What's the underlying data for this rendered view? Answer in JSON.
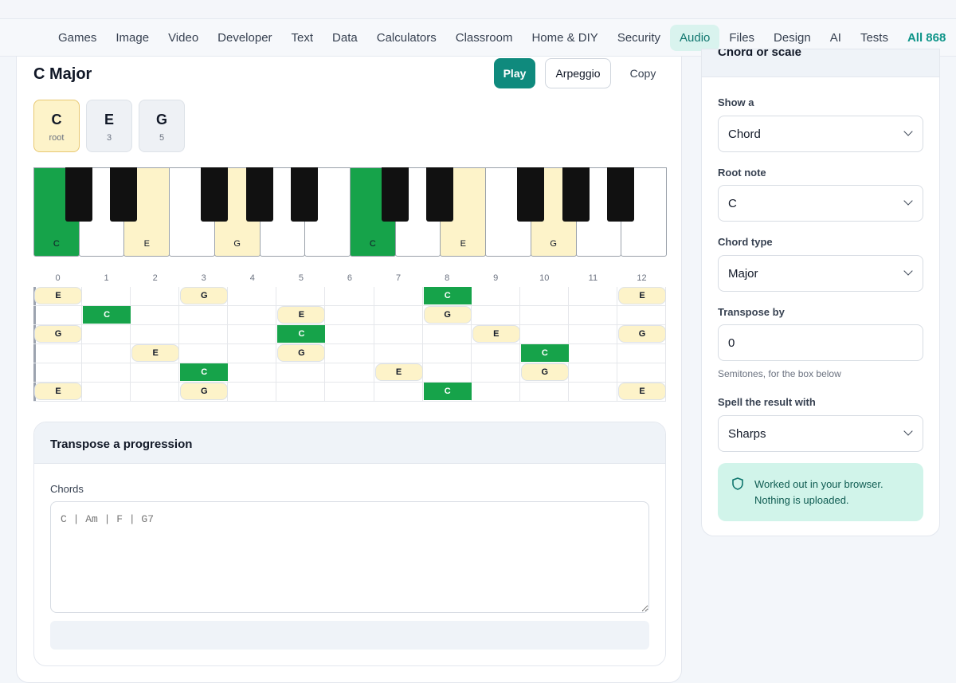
{
  "nav": {
    "items": [
      "Games",
      "Image",
      "Video",
      "Developer",
      "Text",
      "Data",
      "Calculators",
      "Classroom",
      "Home & DIY",
      "Security",
      "Audio",
      "Files",
      "Design",
      "AI",
      "Tests"
    ],
    "active": "Audio",
    "all_label": "All 868"
  },
  "chord": {
    "title": "C Major",
    "play_label": "Play",
    "arpeggio_label": "Arpeggio",
    "copy_label": "Copy",
    "tones": [
      {
        "note": "C",
        "interval": "root"
      },
      {
        "note": "E",
        "interval": "3"
      },
      {
        "note": "G",
        "interval": "5"
      }
    ]
  },
  "piano": {
    "white_keys": [
      "C",
      "",
      "E",
      "",
      "G",
      "",
      "",
      "C",
      "",
      "E",
      "",
      "G",
      "",
      ""
    ],
    "highlight": [
      "root",
      "",
      "tone",
      "",
      "tone",
      "",
      "",
      "root",
      "",
      "tone",
      "",
      "tone",
      "",
      ""
    ]
  },
  "fretboard": {
    "fret_numbers": [
      "0",
      "1",
      "2",
      "3",
      "4",
      "5",
      "6",
      "7",
      "8",
      "9",
      "10",
      "11",
      "12"
    ],
    "strings": [
      [
        "E",
        "",
        "",
        "G",
        "",
        "",
        "",
        "",
        "C",
        "",
        "",
        "",
        "E"
      ],
      [
        "",
        "C",
        "",
        "",
        "",
        "E",
        "",
        "",
        "G",
        "",
        "",
        "",
        ""
      ],
      [
        "G",
        "",
        "",
        "",
        "",
        "C",
        "",
        "",
        "",
        "E",
        "",
        "",
        "G"
      ],
      [
        "",
        "",
        "E",
        "",
        "",
        "G",
        "",
        "",
        "",
        "",
        "C",
        "",
        ""
      ],
      [
        "",
        "",
        "",
        "C",
        "",
        "",
        "",
        "E",
        "",
        "",
        "G",
        "",
        ""
      ],
      [
        "E",
        "",
        "",
        "G",
        "",
        "",
        "",
        "",
        "C",
        "",
        "",
        "",
        "E"
      ]
    ]
  },
  "transpose": {
    "title": "Transpose a progression",
    "chords_label": "Chords",
    "chords_placeholder": "C | Am | F | G7"
  },
  "side": {
    "title": "Chord or scale",
    "show_label": "Show a",
    "show_value": "Chord",
    "root_label": "Root note",
    "root_value": "C",
    "type_label": "Chord type",
    "type_value": "Major",
    "transpose_label": "Transpose by",
    "transpose_value": "0",
    "transpose_help": "Semitones, for the box below",
    "spell_label": "Spell the result with",
    "spell_value": "Sharps",
    "notice": "Worked out in your browser. Nothing is uploaded."
  },
  "colors": {
    "accent": "#0f8a7d",
    "root_note": "#16a34a",
    "chord_tone": "#fdf3c9"
  }
}
